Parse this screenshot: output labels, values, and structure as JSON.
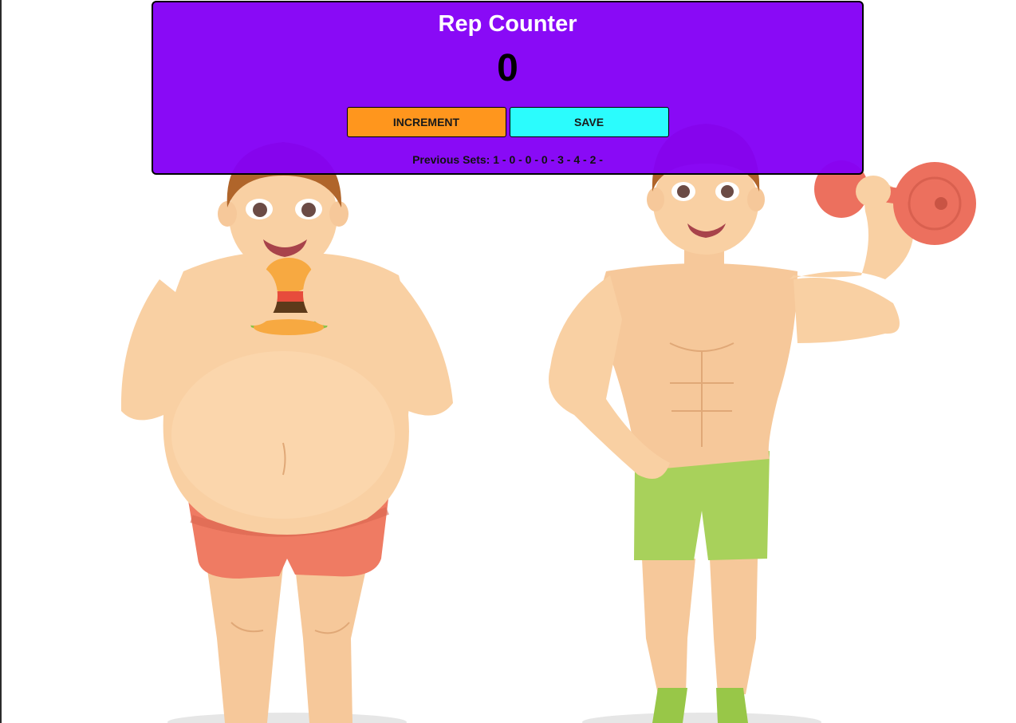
{
  "app": {
    "title": "Rep Counter",
    "count": "0"
  },
  "buttons": {
    "increment_label": "INCREMENT",
    "save_label": "SAVE"
  },
  "history": {
    "label": "Previous Sets:",
    "sets": "1 - 0 - 0 - 0 - 3 - 4 - 2 -"
  },
  "colors": {
    "panel": "#8400f6",
    "increment": "#ff961d",
    "save": "#2bfcfd",
    "skin": "#f9d0a3",
    "red_shorts": "#ef7b63",
    "green_shorts": "#a8d15b",
    "dumbbell": "#ec705e"
  },
  "background": {
    "illustration": "before-after-fitness-illustration",
    "left_figure": "overweight man eating burger",
    "right_figure": "muscular man lifting dumbbell"
  }
}
